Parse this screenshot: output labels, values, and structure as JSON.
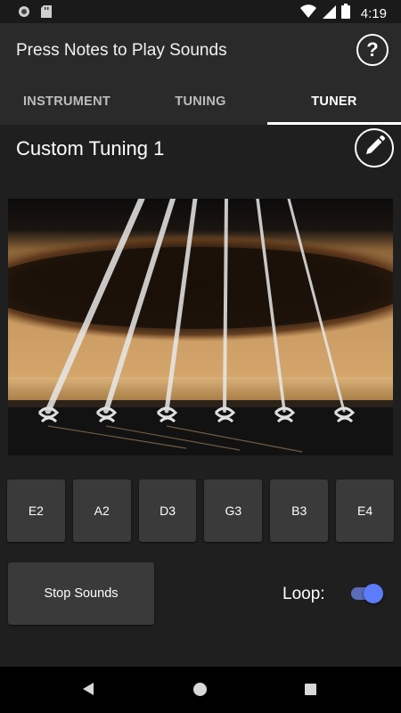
{
  "status_bar": {
    "time": "4:19"
  },
  "app_bar": {
    "title": "Press Notes to Play Sounds",
    "help_label": "?"
  },
  "tabs": [
    {
      "label": "INSTRUMENT",
      "active": false
    },
    {
      "label": "TUNING",
      "active": false
    },
    {
      "label": "TUNER",
      "active": true
    }
  ],
  "tuning": {
    "name": "Custom Tuning 1"
  },
  "notes": [
    "E2",
    "A2",
    "D3",
    "G3",
    "B3",
    "E4"
  ],
  "controls": {
    "stop_label": "Stop Sounds",
    "loop_label": "Loop:",
    "loop_on": true
  },
  "colors": {
    "accent": "#5c7cfa",
    "appbar": "#2a2a2a",
    "button": "#3a3a3a",
    "background": "#1f1f1f"
  },
  "icons": [
    "media-icon",
    "sd-card-icon",
    "wifi-icon",
    "signal-icon",
    "battery-icon",
    "help-icon",
    "pencil-icon",
    "back-icon",
    "home-icon",
    "recents-icon"
  ]
}
